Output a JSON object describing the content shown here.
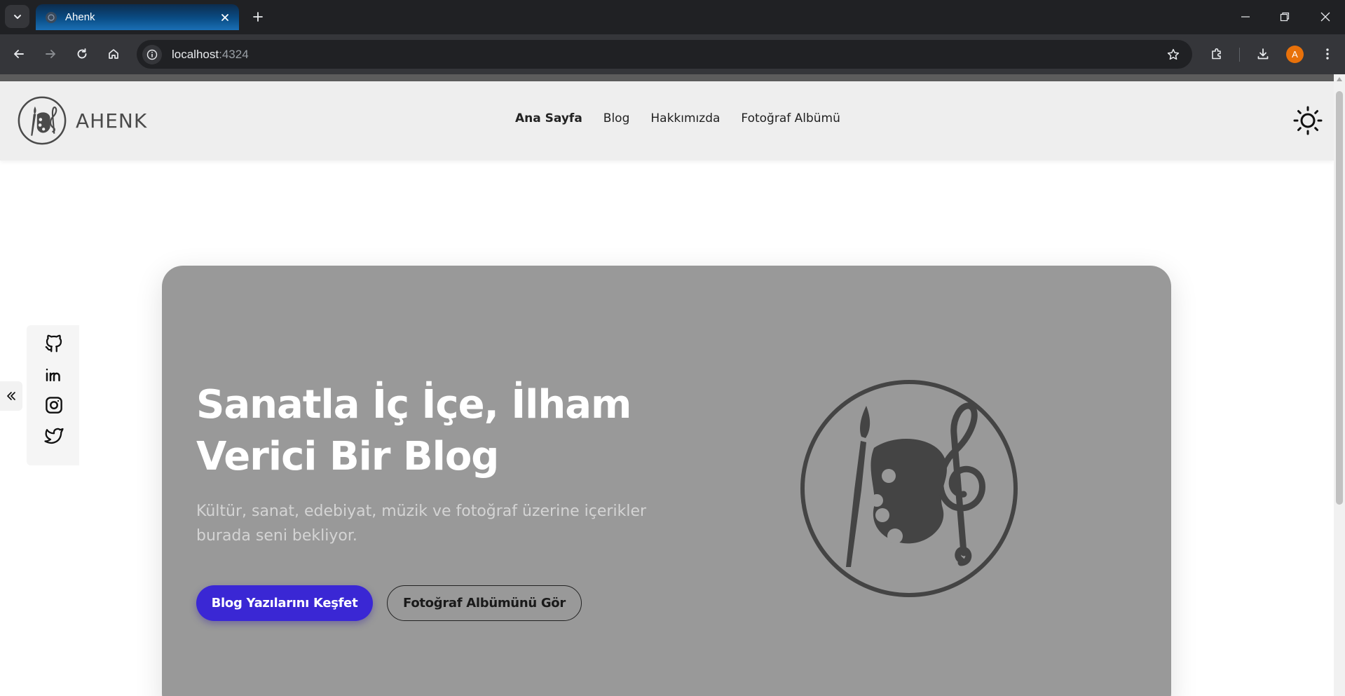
{
  "browser": {
    "tab_title": "Ahenk",
    "url_host": "localhost",
    "url_port": ":4324",
    "profile_initial": "A"
  },
  "site": {
    "logo_text": "AHENK",
    "nav": [
      {
        "label": "Ana Sayfa",
        "active": true
      },
      {
        "label": "Blog",
        "active": false
      },
      {
        "label": "Hakkımızda",
        "active": false
      },
      {
        "label": "Fotoğraf Albümü",
        "active": false
      }
    ],
    "social_icons": [
      "github-icon",
      "linkedin-icon",
      "instagram-icon",
      "twitter-icon"
    ],
    "collapse_icon": "double-chevron-left-icon",
    "theme_icon": "sun-icon"
  },
  "hero": {
    "title_line1": "Sanatla İç İçe, İlham",
    "title_line2": "Verici Bir Blog",
    "subtitle_line1": "Kültür, sanat, edebiyat, müzik ve fotoğraf üzerine içerikler",
    "subtitle_line2": "burada seni bekliyor.",
    "primary_button": "Blog Yazılarını Keşfet",
    "secondary_button": "Fotoğraf Albümünü Gör",
    "art_icon": "palette-treble-clef-icon"
  },
  "colors": {
    "primary": "#3a27d4",
    "hero_bg": "#999999",
    "header_bg": "#eeeeee",
    "logo_gray": "#4a4a4a"
  }
}
